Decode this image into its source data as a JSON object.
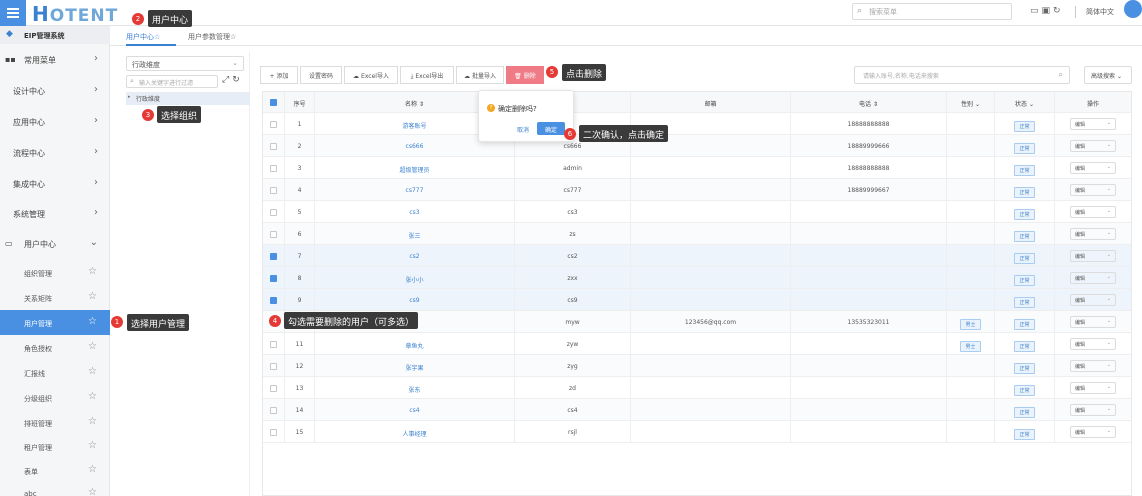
{
  "app": {
    "logo_h": "H",
    "logo_rest": "OTENT",
    "search_placeholder": "搜索菜单",
    "language": "简体中文"
  },
  "sidebar": {
    "system_title": "EIP管理系统",
    "items": [
      {
        "label": "常用菜单"
      },
      {
        "label": "设计中心"
      },
      {
        "label": "应用中心"
      },
      {
        "label": "流程中心"
      },
      {
        "label": "集成中心"
      },
      {
        "label": "系统管理"
      },
      {
        "label": "用户中心"
      }
    ],
    "subitems": [
      {
        "label": "组织管理"
      },
      {
        "label": "关系矩阵"
      },
      {
        "label": "用户管理"
      },
      {
        "label": "角色授权"
      },
      {
        "label": "汇报线"
      },
      {
        "label": "分级组织"
      },
      {
        "label": "排班管理"
      },
      {
        "label": "租户管理"
      },
      {
        "label": "表单"
      },
      {
        "label": "abc"
      }
    ]
  },
  "tabs": [
    {
      "label": "用户中心☆"
    },
    {
      "label": "用户参数管理☆"
    }
  ],
  "org": {
    "dimension": "行政维度",
    "search_placeholder": "输入关键字进行过滤",
    "root_node": "行政维度"
  },
  "toolbar": {
    "add": "添加",
    "reset_pwd": "设置密码",
    "excel_import": "Excel导入",
    "excel_export": "Excel导出",
    "batch_import": "批量导入",
    "delete": "删除",
    "search_placeholder": "请输入账号,名称,电话来搜索",
    "advanced": "高级搜索"
  },
  "table": {
    "headers": {
      "no": "序号",
      "name": "名称 ⇕",
      "email": "邮箱",
      "phone": "电话 ⇕",
      "sex": "性别 ⌄",
      "status": "状态 ⌄",
      "op": "操作"
    },
    "rows": [
      {
        "no": "1",
        "name": "游客账号",
        "account": "",
        "email": "",
        "phone": "18888888888",
        "sex": "",
        "status": "正常",
        "op": "编辑",
        "checked": false
      },
      {
        "no": "2",
        "name": "cs666",
        "account": "cs666",
        "email": "",
        "phone": "18889999666",
        "sex": "",
        "status": "正常",
        "op": "编辑",
        "checked": false
      },
      {
        "no": "3",
        "name": "超级管理员",
        "account": "admin",
        "email": "",
        "phone": "18888888888",
        "sex": "",
        "status": "正常",
        "op": "编辑",
        "checked": false
      },
      {
        "no": "4",
        "name": "cs777",
        "account": "cs777",
        "email": "",
        "phone": "18889999667",
        "sex": "",
        "status": "正常",
        "op": "编辑",
        "checked": false
      },
      {
        "no": "5",
        "name": "cs3",
        "account": "cs3",
        "email": "",
        "phone": "",
        "sex": "",
        "status": "正常",
        "op": "编辑",
        "checked": false
      },
      {
        "no": "6",
        "name": "张三",
        "account": "zs",
        "email": "",
        "phone": "",
        "sex": "",
        "status": "正常",
        "op": "编辑",
        "checked": false
      },
      {
        "no": "7",
        "name": "cs2",
        "account": "cs2",
        "email": "",
        "phone": "",
        "sex": "",
        "status": "正常",
        "op": "编辑",
        "checked": true
      },
      {
        "no": "8",
        "name": "张小小",
        "account": "zxx",
        "email": "",
        "phone": "",
        "sex": "",
        "status": "正常",
        "op": "编辑",
        "checked": true
      },
      {
        "no": "9",
        "name": "cs9",
        "account": "cs9",
        "email": "",
        "phone": "",
        "sex": "",
        "status": "正常",
        "op": "编辑",
        "checked": true
      },
      {
        "no": "",
        "name": "",
        "account": "myw",
        "email": "123456@qq.com",
        "phone": "13535323011",
        "sex": "男士",
        "status": "正常",
        "op": "编辑",
        "checked": false
      },
      {
        "no": "11",
        "name": "章鱼丸",
        "account": "zyw",
        "email": "",
        "phone": "",
        "sex": "男士",
        "status": "正常",
        "op": "编辑",
        "checked": false
      },
      {
        "no": "12",
        "name": "张宇果",
        "account": "zyg",
        "email": "",
        "phone": "",
        "sex": "",
        "status": "正常",
        "op": "编辑",
        "checked": false
      },
      {
        "no": "13",
        "name": "张东",
        "account": "zd",
        "email": "",
        "phone": "",
        "sex": "",
        "status": "正常",
        "op": "编辑",
        "checked": false
      },
      {
        "no": "14",
        "name": "cs4",
        "account": "cs4",
        "email": "",
        "phone": "",
        "sex": "",
        "status": "正常",
        "op": "编辑",
        "checked": false
      },
      {
        "no": "15",
        "name": "人事经理",
        "account": "rsjl",
        "email": "",
        "phone": "",
        "sex": "",
        "status": "正常",
        "op": "编辑",
        "checked": false
      }
    ]
  },
  "popover": {
    "message": "确定删除吗?",
    "cancel": "取消",
    "confirm": "确定"
  },
  "callouts": [
    {
      "num": "1",
      "text": "选择用户管理"
    },
    {
      "num": "2",
      "text": "用户中心"
    },
    {
      "num": "3",
      "text": "选择组织"
    },
    {
      "num": "4",
      "text": "勾选需要删除的用户（可多选）"
    },
    {
      "num": "5",
      "text": "点击删除"
    },
    {
      "num": "6",
      "text": "二次确认，点击确定"
    }
  ],
  "colors": {
    "primary": "#4a90e2",
    "danger": "#ee7b86",
    "callout_bg": "#3a3a3a",
    "callout_num": "#e53935"
  }
}
